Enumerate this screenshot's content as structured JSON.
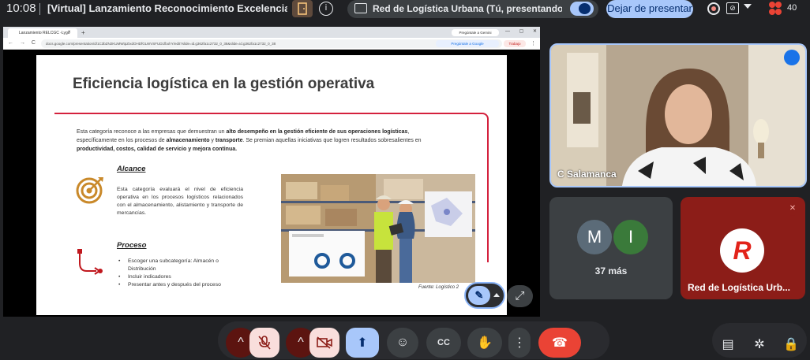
{
  "meeting": {
    "time": "10:08",
    "title": "[Virtual] Lanzamiento Reconocimiento Excelencia L...",
    "presenting_text": "Red de Logística Urbana (Tú, presentando y an...",
    "stop_presenting": "Dejar de presentar",
    "participant_count": "40"
  },
  "browser": {
    "tab_title": "Lanzamiento RELCGC -Lygo",
    "tab_close": "×",
    "new_tab": "+",
    "tab2_title": "Pregúntale a Gemini",
    "window_controls": "— ▢ ✕",
    "nav": "← → C",
    "url": "docs.google.com/presentation/d/1C3bZN2KUMWtpZIxdOHDfGLWVSFUD1fbohY/edit?slide=id.g362fa1c2732_0_38&slide=id.g362fa1c2732_0_38",
    "ask_google": "Pregúntale a Google",
    "trabajo": "Trabajo",
    "menu_dots": "⋮"
  },
  "slide": {
    "title": "Eficiencia logística en la gestión operativa",
    "intro_parts": [
      {
        "t": "Esta categoría reconoce a las empresas que demuestran un ",
        "b": false
      },
      {
        "t": "alto desempeño en la gestión eficiente de sus operaciones logísticas",
        "b": true
      },
      {
        "t": ", específicamente en los procesos de ",
        "b": false
      },
      {
        "t": "almacenamiento",
        "b": true
      },
      {
        "t": " y ",
        "b": false
      },
      {
        "t": "transporte",
        "b": true
      },
      {
        "t": ". Se premian aquellas iniciativas que logren resultados sobresalientes en ",
        "b": false
      },
      {
        "t": "productividad, costos, calidad de servicio y mejora continua.",
        "b": true
      }
    ],
    "alcance_heading": "Alcance",
    "alcance_text": "Esta categoría evaluará el nivel de eficiencia operativa en los procesos logísticos relacionados con el almacenamiento, alistamiento y transporte de mercancías.",
    "proceso_heading": "Proceso",
    "proceso_items": [
      "Escoger una subcategoría: Almacén o Distribución",
      "Incluir indicadores",
      "Presentar antes y después del proceso"
    ],
    "caption": "Fuente: Logístico 2"
  },
  "video": {
    "camera_name": "C Salamanca",
    "more_avatars": [
      "M",
      "I"
    ],
    "more_text": "37 más",
    "org_name": "Red de Logística Urb...",
    "org_logo_letter": "R"
  },
  "colors": {
    "accent_red": "#d4213d",
    "meet_blue": "#a8c7fa",
    "end_call": "#ea4335"
  },
  "icons": {
    "mic": "mic-off-icon",
    "cam": "videocam-off-icon",
    "present": "present-to-all-icon",
    "emoji": "emoji-icon",
    "cc": "closed-captions-icon",
    "hand": "raise-hand-icon",
    "more": "more-vert-icon",
    "end": "call-end-icon",
    "chat": "chat-icon",
    "activities": "activities-icon",
    "host": "host-controls-icon"
  },
  "controls": {
    "mic_glyph": "🎙",
    "cam_glyph": "⧄",
    "caret": "^",
    "present_glyph": "⬆",
    "emoji_glyph": "☺",
    "cc_glyph": "CC",
    "hand_glyph": "✋",
    "more_glyph": "⋮",
    "end_glyph": "☎",
    "chat_glyph": "▤",
    "act_glyph": "✲",
    "host_glyph": "🔒",
    "expand_glyph": "⤢",
    "annotate_glyph": "✎"
  }
}
